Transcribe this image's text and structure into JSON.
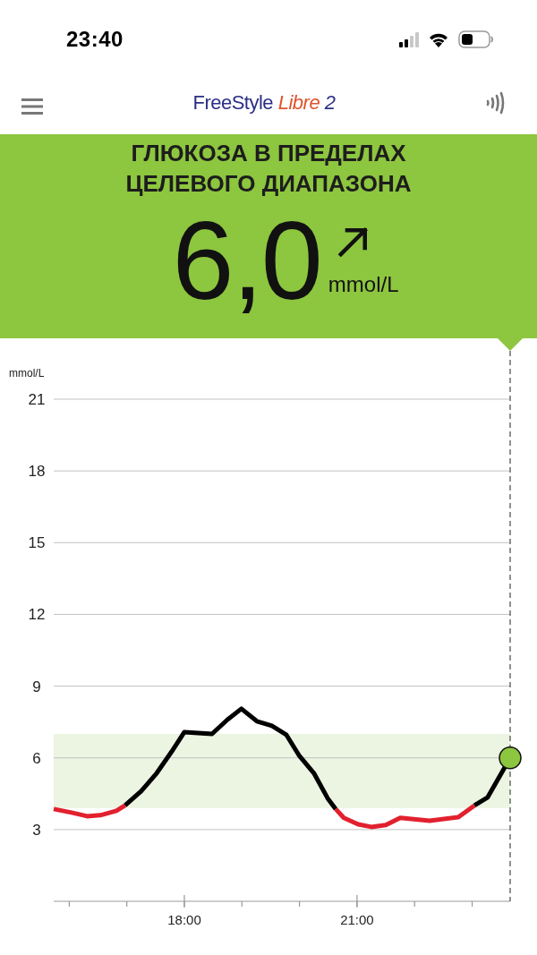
{
  "status_bar": {
    "time": "23:40"
  },
  "header": {
    "logo": {
      "brand": "FreeStyle",
      "product": "Libre",
      "version": "2"
    }
  },
  "banner": {
    "status_lines": [
      "ГЛЮКОЗА В ПРЕДЕЛАХ",
      "ЦЕЛЕВОГО ДИАПАЗОНА"
    ],
    "value": "6,0",
    "unit": "mmol/L"
  },
  "chart": {
    "chart_data": {
      "type": "line",
      "ylabel": "mmol/L",
      "x": [
        15.73,
        16.04,
        16.31,
        16.54,
        16.82,
        16.97,
        17.25,
        17.52,
        17.78,
        18.0,
        18.48,
        18.75,
        18.99,
        19.26,
        19.52,
        19.77,
        19.99,
        20.25,
        20.49,
        20.63,
        20.77,
        21.02,
        21.25,
        21.5,
        21.75,
        22.26,
        22.76,
        23.04,
        23.27,
        23.66
      ],
      "series": [
        {
          "color": "#000000",
          "values": [
            null,
            null,
            null,
            null,
            null,
            4.01,
            4.61,
            5.36,
            6.26,
            7.08,
            7.0,
            7.6,
            8.05,
            7.53,
            7.34,
            6.97,
            6.11,
            5.36,
            4.31,
            3.86,
            null,
            null,
            null,
            null,
            null,
            null,
            null,
            4.01,
            4.35,
            6.0
          ]
        },
        {
          "color": "#e2202e",
          "values": [
            3.86,
            3.71,
            3.56,
            3.6,
            3.79,
            4.01,
            null,
            null,
            null,
            null,
            null,
            null,
            null,
            null,
            null,
            null,
            null,
            null,
            null,
            3.86,
            3.49,
            3.22,
            3.11,
            3.19,
            3.49,
            3.37,
            3.52,
            4.01,
            null,
            null
          ]
        }
      ],
      "xlim": [
        15.73,
        23.66
      ],
      "ylim": [
        0,
        21
      ],
      "xticks": [
        {
          "value": 18,
          "label": "18:00"
        },
        {
          "value": 21,
          "label": "21:00"
        }
      ],
      "yticks": [
        3,
        6,
        9,
        12,
        15,
        18,
        21
      ],
      "grid": true,
      "bands": [
        {
          "axis": "y",
          "from": 3.9,
          "to": 7.0
        }
      ]
    }
  }
}
